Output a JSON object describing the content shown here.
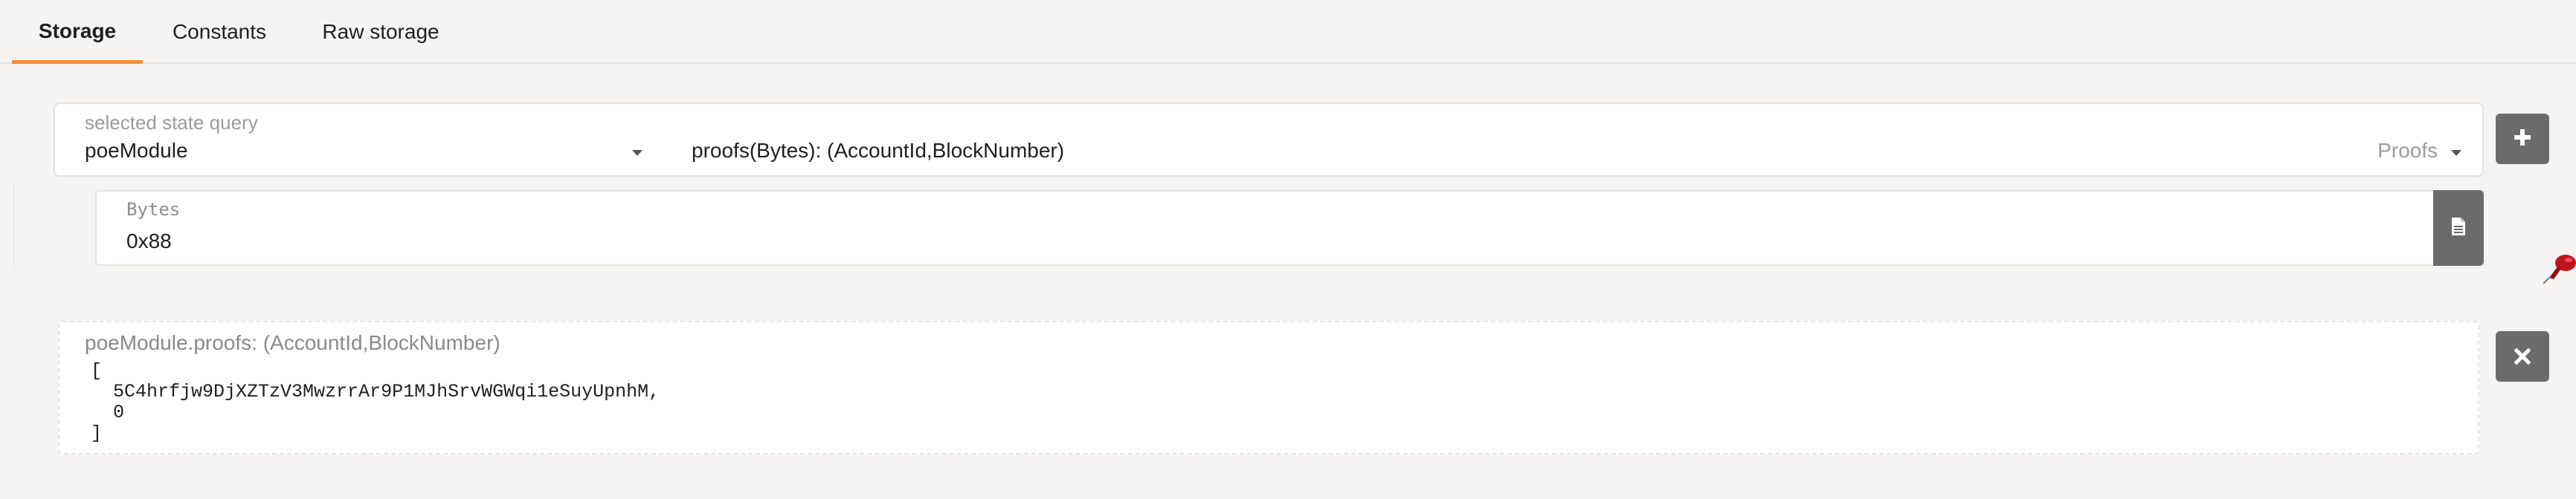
{
  "tabs": [
    {
      "label": "Storage",
      "active": true
    },
    {
      "label": "Constants",
      "active": false
    },
    {
      "label": "Raw storage",
      "active": false
    }
  ],
  "query": {
    "label": "selected state query",
    "module": "poeModule",
    "method": "proofs(Bytes): (AccountId,BlockNumber)",
    "section_hint": "Proofs",
    "add_button_icon": "plus-icon"
  },
  "param": {
    "label": "Bytes",
    "value": "0x88",
    "file_button_icon": "file-icon"
  },
  "result": {
    "title": "poeModule.proofs: (AccountId,BlockNumber)",
    "lines": [
      "[",
      "  5C4hrfjw9DjXZTzV3MwzrrAr9P1MJhSrvWGWqi1eSuyUpnhM,",
      "  0",
      "]"
    ],
    "close_button_icon": "close-icon"
  },
  "colors": {
    "accent": "#f19135",
    "button_bg": "#6b6b6b",
    "background": "#f5f4f3"
  }
}
